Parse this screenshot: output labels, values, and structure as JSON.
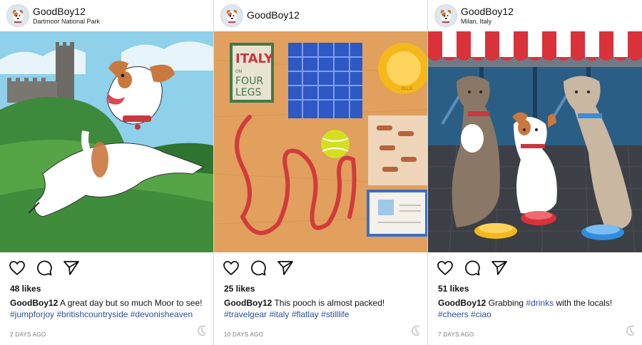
{
  "posts": [
    {
      "username": "GoodBoy12",
      "location": "Dartmoor National Park",
      "likes": "48 likes",
      "caption_user": "GoodBoy12",
      "caption_text": " A great day but so much Moor to see!",
      "hashtags": "#jumpforjoy #britishcountryside #devonisheaven",
      "timestamp": "2 DAYS AGO",
      "image": "dog-jumping-on-dartmoor-hill-with-castle"
    },
    {
      "username": "GoodBoy12",
      "location": "",
      "likes": "25 likes",
      "caption_user": "GoodBoy12",
      "caption_text": " This pooch is almost packed!",
      "hashtags": "#travelgear #italy #flatlay #stilllife",
      "timestamp": "10 DAYS AGO",
      "image": "flatlay-travel-gear",
      "book": {
        "title_top": "ITALY",
        "title_on": "ON",
        "title_four": "FOUR",
        "title_legs": "LEGS"
      },
      "bowl_text": "OLLIE"
    },
    {
      "username": "GoodBoy12",
      "location": "Milan, Italy",
      "likes": "51 likes",
      "caption_user": "GoodBoy12",
      "caption_pre": " Grabbing ",
      "caption_tag": "#drinks",
      "caption_post": " with the locals!",
      "hashtags": "#cheers #ciao",
      "timestamp": "7 DAYS AGO",
      "image": "dogs-at-cafe-with-water-bowls"
    }
  ],
  "icons": [
    "heart-icon",
    "comment-icon",
    "share-icon",
    "app-watermark-icon"
  ],
  "colors": {
    "hashtag": "#2d4fa0",
    "awning_red": "#d9323b",
    "sky_blue": "#8fd0ea"
  }
}
